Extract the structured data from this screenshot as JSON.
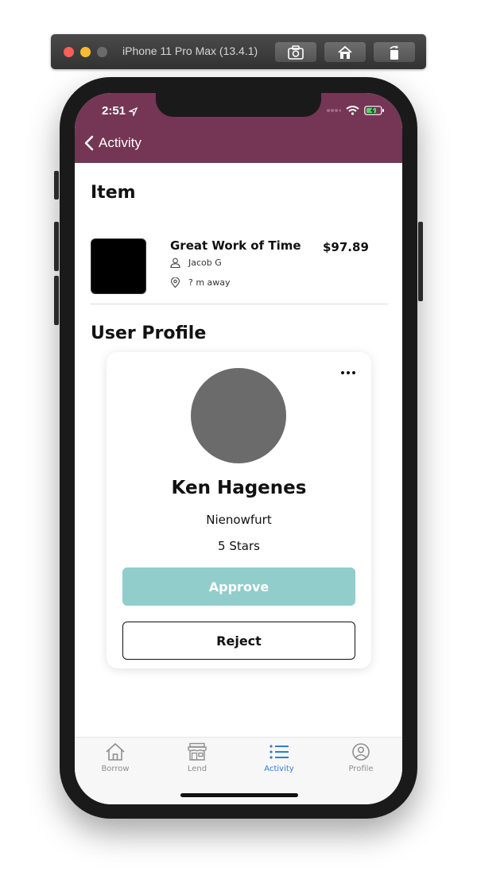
{
  "simulator": {
    "title": "iPhone 11 Pro Max (13.4.1)",
    "buttons": [
      "screenshot-icon",
      "home-icon",
      "rotate-icon"
    ]
  },
  "status_bar": {
    "time": "2:51",
    "icons": [
      "location-arrow-icon",
      "wifi-icon",
      "battery-icon"
    ]
  },
  "nav": {
    "back_label": "Activity",
    "back_icon": "chevron-left-icon",
    "color": "#743654"
  },
  "item_section": {
    "title": "Item",
    "item": {
      "name": "Great Work of Time",
      "price": "$97.89",
      "owner": "Jacob G",
      "distance": "? m away"
    }
  },
  "profile_section": {
    "title": "User Profile",
    "user": {
      "name": "Ken Hagenes",
      "location": "Nienowfurt",
      "rating": "5 Stars"
    },
    "approve_label": "Approve",
    "reject_label": "Reject",
    "approve_color": "#91cdcb"
  },
  "tabbar": {
    "tabs": [
      {
        "label": "Borrow",
        "icon": "house-icon"
      },
      {
        "label": "Lend",
        "icon": "storefront-icon"
      },
      {
        "label": "Activity",
        "icon": "list-icon",
        "active": true
      },
      {
        "label": "Profile",
        "icon": "user-circle-icon"
      }
    ],
    "active_color": "#2f7dd6"
  }
}
